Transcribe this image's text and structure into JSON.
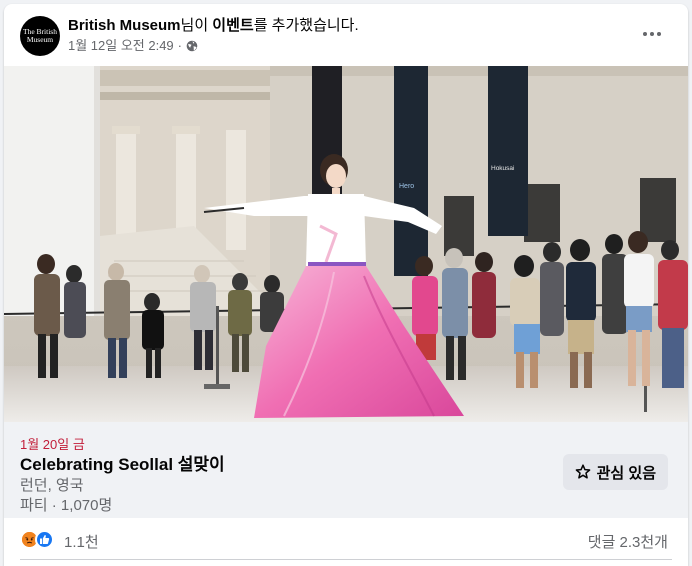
{
  "post": {
    "page_name": "British Museum",
    "logo_line1": "The British",
    "logo_line2": "Museum",
    "action_prefix": "님이 ",
    "action_event": "이벤트",
    "action_suffix": "를 추가했습니다.",
    "timestamp": "1월 12일 오전 2:49",
    "separator": "·",
    "more_icon": "more-horizontal-icon",
    "privacy_icon": "globe-icon"
  },
  "photo": {
    "banner_left": "Hero the man behind the myth",
    "banner_right": "Hokusai The Great Picture Book of Everything"
  },
  "event": {
    "date": "1월 20일 금",
    "title": "Celebrating Seollal 설맞이",
    "location": "런던, 영국",
    "meta": "파티 · 1,070명",
    "interest_label": "관심 있음",
    "date_color": "#c21e3a"
  },
  "footer": {
    "reactions": [
      "angry",
      "like"
    ],
    "reaction_count": "1.1천",
    "comment_count": "댓글 2.3천개"
  }
}
